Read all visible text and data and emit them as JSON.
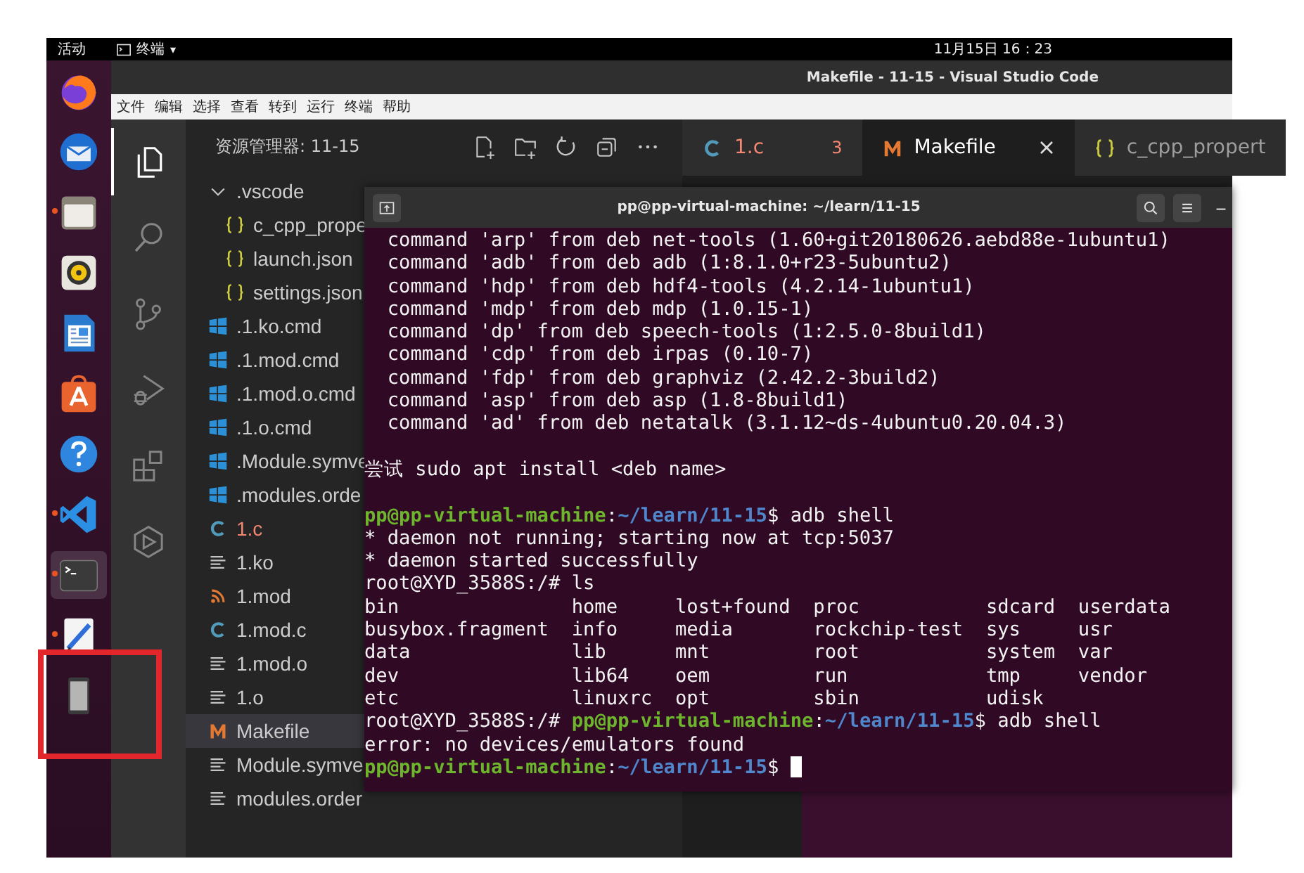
{
  "top_bar": {
    "activities": "活动",
    "app_menu": "终端",
    "caret": "▾",
    "clock": "11月15日 16：23"
  },
  "dock": [
    {
      "kind": "firefox",
      "running": false,
      "selected": false,
      "highlighted": false
    },
    {
      "kind": "mail",
      "running": false,
      "selected": false,
      "highlighted": false
    },
    {
      "kind": "files",
      "running": true,
      "selected": false,
      "highlighted": false
    },
    {
      "kind": "speaker",
      "running": false,
      "selected": false,
      "highlighted": false
    },
    {
      "kind": "document",
      "running": false,
      "selected": false,
      "highlighted": false
    },
    {
      "kind": "store",
      "running": false,
      "selected": false,
      "highlighted": false
    },
    {
      "kind": "help",
      "running": false,
      "selected": false,
      "highlighted": false
    },
    {
      "kind": "code",
      "running": true,
      "selected": false,
      "highlighted": false
    },
    {
      "kind": "terminal",
      "running": true,
      "selected": true,
      "highlighted": false
    },
    {
      "kind": "editor",
      "running": true,
      "selected": false,
      "highlighted": false
    },
    {
      "kind": "tablet",
      "running": false,
      "selected": false,
      "highlighted": true
    }
  ],
  "window": {
    "title": "Makefile - 11-15 - Visual Studio Code"
  },
  "menu": [
    "文件",
    "编辑",
    "选择",
    "查看",
    "转到",
    "运行",
    "终端",
    "帮助"
  ],
  "activity_bar": [
    {
      "kind": "explorer",
      "selected": true
    },
    {
      "kind": "search",
      "selected": false
    },
    {
      "kind": "branch",
      "selected": false
    },
    {
      "kind": "debug",
      "selected": false
    },
    {
      "kind": "extensions",
      "selected": false
    },
    {
      "kind": "hexagon",
      "selected": false
    }
  ],
  "explorer": {
    "title": "资源管理器: 11-15",
    "tree": [
      {
        "label": ".vscode",
        "kind": "folder",
        "expanded": true,
        "selected": false,
        "error": false,
        "children": [
          {
            "label": "c_cpp_prope",
            "kind": "json",
            "selected": false,
            "error": false
          },
          {
            "label": "launch.json",
            "kind": "json",
            "selected": false,
            "error": false
          },
          {
            "label": "settings.json",
            "kind": "json",
            "selected": false,
            "error": false
          }
        ]
      },
      {
        "label": ".1.ko.cmd",
        "kind": "windows",
        "selected": false,
        "error": false
      },
      {
        "label": ".1.mod.cmd",
        "kind": "windows",
        "selected": false,
        "error": false
      },
      {
        "label": ".1.mod.o.cmd",
        "kind": "windows",
        "selected": false,
        "error": false
      },
      {
        "label": ".1.o.cmd",
        "kind": "windows",
        "selected": false,
        "error": false
      },
      {
        "label": ".Module.symve",
        "kind": "windows",
        "selected": false,
        "error": false
      },
      {
        "label": ".modules.orde",
        "kind": "windows",
        "selected": false,
        "error": false
      },
      {
        "label": "1.c",
        "kind": "c",
        "selected": false,
        "error": true
      },
      {
        "label": "1.ko",
        "kind": "lines",
        "selected": false,
        "error": false
      },
      {
        "label": "1.mod",
        "kind": "rss",
        "selected": false,
        "error": false
      },
      {
        "label": "1.mod.c",
        "kind": "c",
        "selected": false,
        "error": false
      },
      {
        "label": "1.mod.o",
        "kind": "lines",
        "selected": false,
        "error": false
      },
      {
        "label": "1.o",
        "kind": "lines",
        "selected": false,
        "error": false
      },
      {
        "label": "Makefile",
        "kind": "make",
        "selected": true,
        "error": false
      },
      {
        "label": "Module.symve",
        "kind": "lines",
        "selected": false,
        "error": false
      },
      {
        "label": "modules.order",
        "kind": "lines",
        "selected": false,
        "error": false
      }
    ]
  },
  "tabs": [
    {
      "label": "1.c",
      "kind": "c",
      "selected": false,
      "error": true,
      "problems": "3"
    },
    {
      "label": "Makefile",
      "kind": "make",
      "selected": true,
      "error": false
    },
    {
      "label": "c_cpp_propert",
      "kind": "json",
      "selected": false,
      "error": false
    }
  ],
  "terminal": {
    "title": "pp@pp-virtual-machine: ~/learn/11-15",
    "lines": [
      {
        "indented": true,
        "blank_before": false,
        "segments": [
          {
            "text": "command 'arp' from deb net-tools (1.60+git20180626.aebd88e-1ubuntu1)",
            "kind": "plain"
          }
        ]
      },
      {
        "indented": true,
        "blank_before": false,
        "segments": [
          {
            "text": "command 'adb' from deb adb (1:8.1.0+r23-5ubuntu2)",
            "kind": "plain"
          }
        ]
      },
      {
        "indented": true,
        "blank_before": false,
        "segments": [
          {
            "text": "command 'hdp' from deb hdf4-tools (4.2.14-1ubuntu1)",
            "kind": "plain"
          }
        ]
      },
      {
        "indented": true,
        "blank_before": false,
        "segments": [
          {
            "text": "command 'mdp' from deb mdp (1.0.15-1)",
            "kind": "plain"
          }
        ]
      },
      {
        "indented": true,
        "blank_before": false,
        "segments": [
          {
            "text": "command 'dp' from deb speech-tools (1:2.5.0-8build1)",
            "kind": "plain"
          }
        ]
      },
      {
        "indented": true,
        "blank_before": false,
        "segments": [
          {
            "text": "command 'cdp' from deb irpas (0.10-7)",
            "kind": "plain"
          }
        ]
      },
      {
        "indented": true,
        "blank_before": false,
        "segments": [
          {
            "text": "command 'fdp' from deb graphviz (2.42.2-3build2)",
            "kind": "plain"
          }
        ]
      },
      {
        "indented": true,
        "blank_before": false,
        "segments": [
          {
            "text": "command 'asp' from deb asp (1.8-8build1)",
            "kind": "plain"
          }
        ]
      },
      {
        "indented": true,
        "blank_before": false,
        "segments": [
          {
            "text": "command 'ad' from deb netatalk (3.1.12~ds-4ubuntu0.20.04.3)",
            "kind": "plain"
          }
        ]
      },
      {
        "indented": false,
        "blank_before": true,
        "segments": [
          {
            "text": "尝试 sudo apt install <deb name>",
            "kind": "plain"
          }
        ]
      },
      {
        "indented": false,
        "blank_before": true,
        "segments": [
          {
            "text": "pp@pp-virtual-machine",
            "kind": "user"
          },
          {
            "text": ":",
            "kind": "plain"
          },
          {
            "text": "~/learn/11-15",
            "kind": "path"
          },
          {
            "text": "$ adb shell",
            "kind": "plain"
          }
        ]
      },
      {
        "indented": false,
        "blank_before": false,
        "segments": [
          {
            "text": "* daemon not running; starting now at tcp:5037",
            "kind": "plain"
          }
        ]
      },
      {
        "indented": false,
        "blank_before": false,
        "segments": [
          {
            "text": "* daemon started successfully",
            "kind": "plain"
          }
        ]
      },
      {
        "indented": false,
        "blank_before": false,
        "segments": [
          {
            "text": "root@XYD_3588S:/# ls",
            "kind": "plain"
          }
        ]
      },
      {
        "indented": false,
        "blank_before": false,
        "segments": [
          {
            "text": "bin               home     lost+found  proc           sdcard  userdata",
            "kind": "plain"
          }
        ]
      },
      {
        "indented": false,
        "blank_before": false,
        "segments": [
          {
            "text": "busybox.fragment  info     media       rockchip-test  sys     usr",
            "kind": "plain"
          }
        ]
      },
      {
        "indented": false,
        "blank_before": false,
        "segments": [
          {
            "text": "data              lib      mnt         root           system  var",
            "kind": "plain"
          }
        ]
      },
      {
        "indented": false,
        "blank_before": false,
        "segments": [
          {
            "text": "dev               lib64    oem         run            tmp     vendor",
            "kind": "plain"
          }
        ]
      },
      {
        "indented": false,
        "blank_before": false,
        "segments": [
          {
            "text": "etc               linuxrc  opt         sbin           udisk",
            "kind": "plain"
          }
        ]
      },
      {
        "indented": false,
        "blank_before": false,
        "segments": [
          {
            "text": "root@XYD_3588S:/#",
            "kind": "plain"
          },
          {
            "text": "pp@pp-virtual-machine",
            "kind": "user",
            "space_before": true
          },
          {
            "text": ":",
            "kind": "plain"
          },
          {
            "text": "~/learn/11-15",
            "kind": "path"
          },
          {
            "text": "$ adb shell",
            "kind": "plain"
          }
        ]
      },
      {
        "indented": false,
        "blank_before": false,
        "segments": [
          {
            "text": "error: no devices/emulators found",
            "kind": "plain"
          }
        ]
      },
      {
        "indented": false,
        "blank_before": false,
        "cursor": true,
        "segments": [
          {
            "text": "pp@pp-virtual-machine",
            "kind": "user"
          },
          {
            "text": ":",
            "kind": "plain"
          },
          {
            "text": "~/learn/11-15",
            "kind": "path"
          },
          {
            "text": "$",
            "kind": "plain"
          }
        ]
      }
    ]
  }
}
